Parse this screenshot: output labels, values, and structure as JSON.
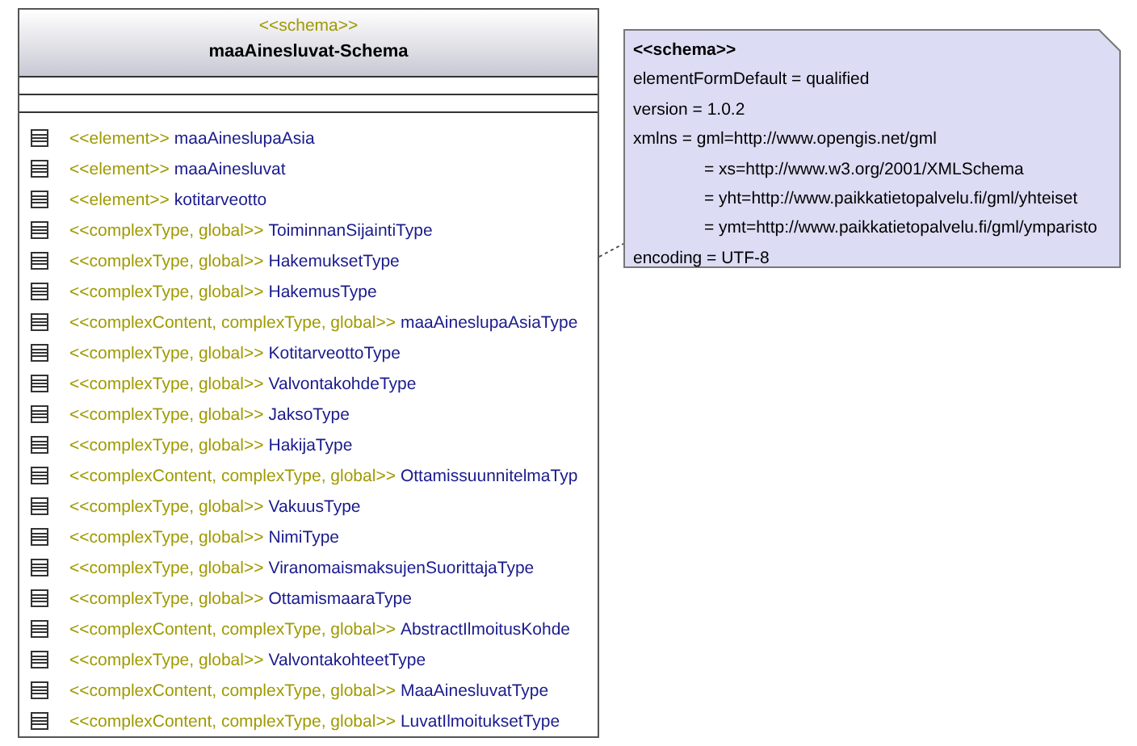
{
  "class_box": {
    "stereotype": "<<schema>>",
    "title": "maaAinesluvat-Schema",
    "items": [
      {
        "stereotype": "<<element>>",
        "name": "maaAineslupaAsia"
      },
      {
        "stereotype": "<<element>>",
        "name": "maaAinesluvat"
      },
      {
        "stereotype": "<<element>>",
        "name": "kotitarveotto"
      },
      {
        "stereotype": "<<complexType, global>>",
        "name": "ToiminnanSijaintiType"
      },
      {
        "stereotype": "<<complexType, global>>",
        "name": "HakemuksetType"
      },
      {
        "stereotype": "<<complexType, global>>",
        "name": "HakemusType"
      },
      {
        "stereotype": "<<complexContent, complexType, global>>",
        "name": "maaAineslupaAsiaType"
      },
      {
        "stereotype": "<<complexType, global>>",
        "name": "KotitarveottoType"
      },
      {
        "stereotype": "<<complexType, global>>",
        "name": "ValvontakohdeType"
      },
      {
        "stereotype": "<<complexType, global>>",
        "name": "JaksoType"
      },
      {
        "stereotype": "<<complexType, global>>",
        "name": "HakijaType"
      },
      {
        "stereotype": "<<complexContent, complexType, global>>",
        "name": "OttamissuunnitelmaTyp"
      },
      {
        "stereotype": "<<complexType, global>>",
        "name": "VakuusType"
      },
      {
        "stereotype": "<<complexType, global>>",
        "name": "NimiType"
      },
      {
        "stereotype": "<<complexType, global>>",
        "name": "ViranomaismaksujenSuorittajaType"
      },
      {
        "stereotype": "<<complexType, global>>",
        "name": "OttamismaaraType"
      },
      {
        "stereotype": "<<complexContent, complexType, global>>",
        "name": "AbstractIlmoitusKohde"
      },
      {
        "stereotype": "<<complexType, global>>",
        "name": "ValvontakohteetType"
      },
      {
        "stereotype": "<<complexContent, complexType, global>>",
        "name": "MaaAinesluvatType"
      },
      {
        "stereotype": "<<complexContent, complexType, global>>",
        "name": "LuvatIlmoituksetType"
      }
    ]
  },
  "note": {
    "title": "<<schema>>",
    "lines": [
      {
        "kind": "attribute",
        "text": "elementFormDefault = qualified"
      },
      {
        "kind": "attribute",
        "text": "version = 1.0.2"
      },
      {
        "kind": "attribute",
        "text": "xmlns = gml=http://www.opengis.net/gml"
      },
      {
        "kind": "continuation",
        "text": "= xs=http://www.w3.org/2001/XMLSchema"
      },
      {
        "kind": "continuation",
        "text": "= yht=http://www.paikkatietopalvelu.fi/gml/yhteiset"
      },
      {
        "kind": "continuation",
        "text": "= ymt=http://www.paikkatietopalvelu.fi/gml/ymparisto"
      },
      {
        "kind": "attribute",
        "text": "encoding = UTF-8"
      }
    ]
  }
}
